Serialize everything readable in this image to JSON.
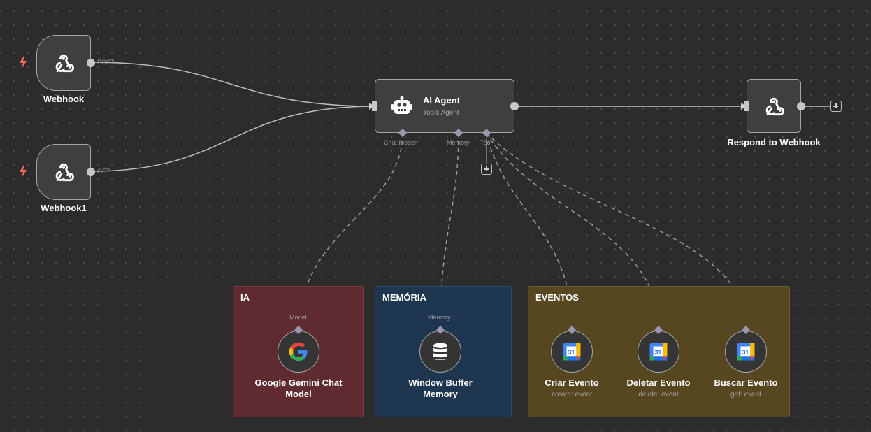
{
  "colors": {
    "background": "#2c2c2c",
    "connection": "#bdbdbd",
    "sticky_ia": "#5f2a30",
    "sticky_memoria": "#1f3650",
    "sticky_eventos": "#564721",
    "trigger_bolt": "#ff6d5a"
  },
  "sticky_notes": {
    "ia": "IA",
    "memoria": "MEMÓRIA",
    "eventos": "EVENTOS"
  },
  "nodes": {
    "webhook": {
      "name": "Webhook",
      "port": "POST",
      "icon": "webhook-icon"
    },
    "webhook1": {
      "name": "Webhook1",
      "port": "GET",
      "icon": "webhook-icon"
    },
    "ai_agent": {
      "name": "AI Agent",
      "subtitle": "Tools Agent",
      "icon": "robot-icon",
      "ports": {
        "chat_model": "Chat Model",
        "required_mark": "*",
        "memory": "Memory",
        "tool": "Tool"
      }
    },
    "respond": {
      "name": "Respond to Webhook",
      "icon": "webhook-icon"
    },
    "gemini": {
      "name_line1": "Google Gemini Chat",
      "name_line2": "Model",
      "port": "Model",
      "icon": "google-icon"
    },
    "buffer": {
      "name_line1": "Window Buffer",
      "name_line2": "Memory",
      "port": "Memory",
      "icon": "database-icon"
    },
    "criar": {
      "name": "Criar Evento",
      "subtitle": "create: event",
      "icon": "google-calendar-icon"
    },
    "deletar": {
      "name": "Deletar Evento",
      "subtitle": "delete: event",
      "icon": "google-calendar-icon"
    },
    "buscar": {
      "name": "Buscar Evento",
      "subtitle": "get: event",
      "icon": "google-calendar-icon"
    }
  },
  "calendar_day": "31"
}
